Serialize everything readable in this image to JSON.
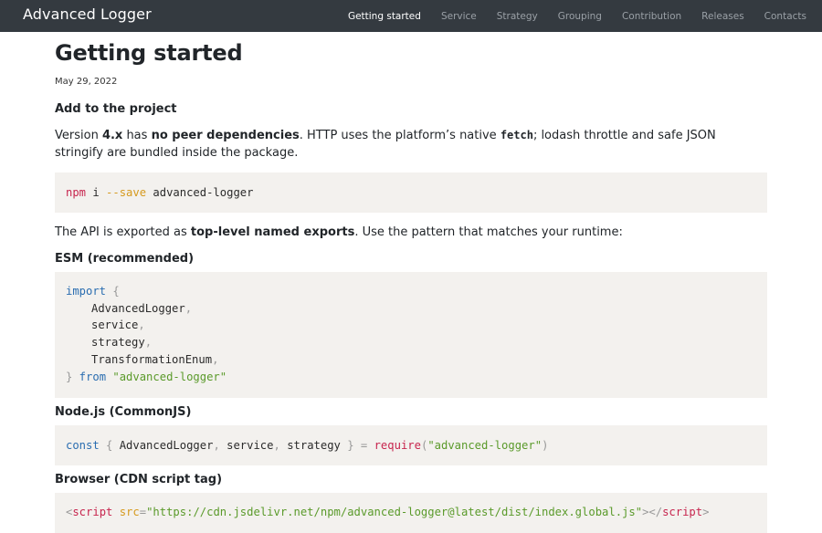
{
  "nav": {
    "brand": "Advanced Logger",
    "links": [
      "Getting started",
      "Service",
      "Strategy",
      "Grouping",
      "Contribution",
      "Releases",
      "Contacts"
    ]
  },
  "page": {
    "title": "Getting started",
    "date": "May 29, 2022",
    "section_add": "Add to the project",
    "p1": {
      "t1": "Version ",
      "b1": "4.x",
      "t2": " has ",
      "b2": "no peer dependencies",
      "t3": ". HTTP uses the platform’s native ",
      "code": "fetch",
      "t4": "; lodash throttle and safe JSON stringify are bundled inside the package."
    },
    "npm": {
      "cmd": "npm",
      "sub": " i ",
      "flag": "--save",
      "pkg": " advanced-logger"
    },
    "p2": {
      "t1": "The API is exported as ",
      "b1": "top-level named exports",
      "t2": ". Use the pattern that matches your runtime:"
    },
    "esm_heading": "ESM (recommended)",
    "esm": {
      "import_kw": "import",
      "open": " {",
      "names": [
        "AdvancedLogger",
        "service",
        "strategy",
        "TransformationEnum"
      ],
      "close": "}",
      "from_kw": " from ",
      "module": "\"advanced-logger\""
    },
    "node_heading": "Node.js (CommonJS)",
    "node": {
      "const_kw": "const",
      "open": " { ",
      "names": [
        "AdvancedLogger",
        "service",
        "strategy"
      ],
      "close": " }",
      "eq": " = ",
      "require": "require",
      "paren_open": "(",
      "module": "\"advanced-logger\"",
      "paren_close": ")"
    },
    "browser_heading": "Browser (CDN script tag)",
    "browser": {
      "lt": "<",
      "tag": "script",
      "attr": " src",
      "eq": "=",
      "url": "\"https://cdn.jsdelivr.net/npm/advanced-logger@latest/dist/index.global.js\"",
      "gt_close": "></",
      "gt": ">"
    }
  },
  "colors": {
    "navbar_bg": "#343a40",
    "code_bg": "#f3f1ee",
    "keyword_blue": "#2a6db0",
    "keyword_red": "#c7254e",
    "string_green": "#5a9a2a"
  }
}
